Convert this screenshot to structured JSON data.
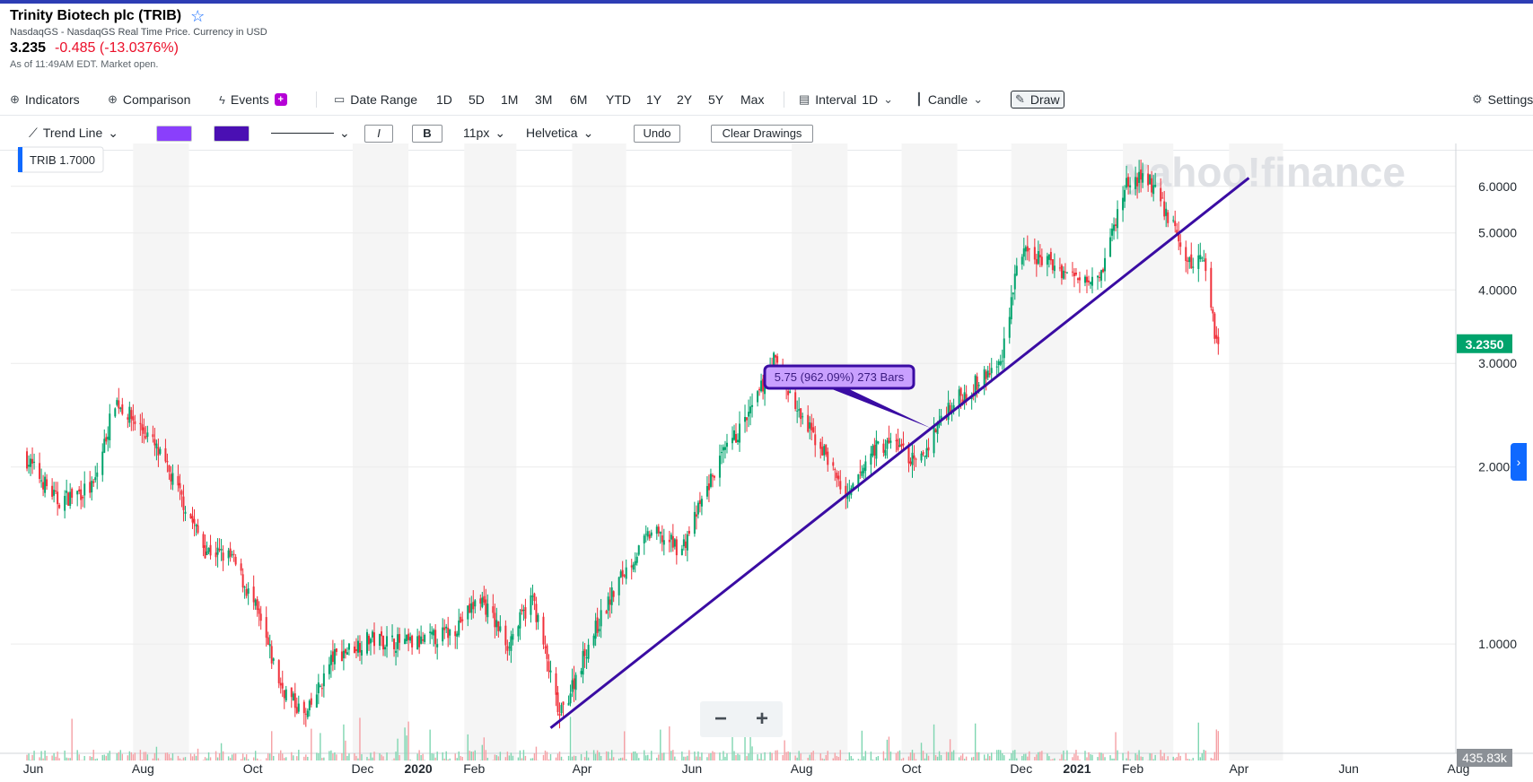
{
  "header": {
    "title": "Trinity Biotech plc (TRIB)",
    "subtitle": "NasdaqGS - NasdaqGS Real Time Price. Currency in USD",
    "price": "3.235",
    "change": "-0.485 (-13.0376%)",
    "as_of": "As of 11:49AM EDT. Market open."
  },
  "toolbar": {
    "indicators": "Indicators",
    "comparison": "Comparison",
    "events": "Events",
    "date_range": "Date Range",
    "ranges": [
      "1D",
      "5D",
      "1M",
      "3M",
      "6M",
      "YTD",
      "1Y",
      "2Y",
      "5Y",
      "Max"
    ],
    "interval_label": "Interval",
    "interval_value": "1D",
    "chart_type": "Candle",
    "draw": "Draw",
    "settings": "Settings"
  },
  "drawbar": {
    "tool": "Trend Line",
    "color1": "#8a3ffc",
    "color2": "#4a0fb3",
    "italic": "I",
    "bold": "B",
    "font_size": "11px",
    "font": "Helvetica",
    "undo": "Undo",
    "clear": "Clear Drawings"
  },
  "chart_data": {
    "type": "candlestick",
    "symbol_label": "TRIB",
    "symbol_value": "1.7000",
    "watermark": "yahoo!finance",
    "x_tick_labels": [
      "Jun",
      "Aug",
      "Oct",
      "Dec",
      "2020",
      "Feb",
      "Apr",
      "Jun",
      "Aug",
      "Oct",
      "Dec",
      "2021",
      "Feb",
      "Apr",
      "Jun",
      "Aug"
    ],
    "y_scale": "log",
    "y_tick_labels": [
      "6.0000",
      "5.0000",
      "4.0000",
      "3.0000",
      "2.0000",
      "1.0000"
    ],
    "y_ticks": [
      6.0,
      5.0,
      4.0,
      3.0,
      2.0,
      1.0
    ],
    "ylim": [
      0.68,
      6.9
    ],
    "current_price_label": "3.2350",
    "current_price": 3.235,
    "volume_label": "435.83k",
    "price_path": [
      [
        "2019-06-01",
        2.1
      ],
      [
        "2019-06-20",
        1.75
      ],
      [
        "2019-07-10",
        1.85
      ],
      [
        "2019-07-22",
        2.6
      ],
      [
        "2019-08-10",
        2.25
      ],
      [
        "2019-08-25",
        1.85
      ],
      [
        "2019-09-10",
        1.45
      ],
      [
        "2019-09-25",
        1.4
      ],
      [
        "2019-10-08",
        1.15
      ],
      [
        "2019-10-22",
        0.85
      ],
      [
        "2019-11-05",
        0.75
      ],
      [
        "2019-11-20",
        0.95
      ],
      [
        "2019-12-10",
        1.02
      ],
      [
        "2020-01-05",
        1.0
      ],
      [
        "2020-01-25",
        1.05
      ],
      [
        "2020-02-10",
        1.2
      ],
      [
        "2020-02-25",
        1.0
      ],
      [
        "2020-03-10",
        1.2
      ],
      [
        "2020-03-25",
        0.75
      ],
      [
        "2020-04-10",
        1.0
      ],
      [
        "2020-04-28",
        1.3
      ],
      [
        "2020-05-15",
        1.55
      ],
      [
        "2020-06-01",
        1.45
      ],
      [
        "2020-06-20",
        2.0
      ],
      [
        "2020-07-10",
        2.5
      ],
      [
        "2020-07-22",
        3.05
      ],
      [
        "2020-08-05",
        2.45
      ],
      [
        "2020-08-20",
        2.1
      ],
      [
        "2020-09-01",
        1.75
      ],
      [
        "2020-09-15",
        2.15
      ],
      [
        "2020-09-28",
        2.2
      ],
      [
        "2020-10-10",
        2.0
      ],
      [
        "2020-10-25",
        2.5
      ],
      [
        "2020-11-10",
        2.75
      ],
      [
        "2020-11-25",
        3.0
      ],
      [
        "2020-12-05",
        4.6
      ],
      [
        "2020-12-20",
        4.5
      ],
      [
        "2021-01-05",
        4.2
      ],
      [
        "2021-01-20",
        4.3
      ],
      [
        "2021-02-03",
        6.1
      ],
      [
        "2021-02-15",
        6.2
      ],
      [
        "2021-02-28",
        5.2
      ],
      [
        "2021-03-10",
        4.4
      ],
      [
        "2021-03-18",
        4.6
      ],
      [
        "2021-03-24",
        3.4
      ],
      [
        "2021-03-26",
        3.235
      ]
    ],
    "trend_line": {
      "start": [
        "2020-03-20",
        0.72
      ],
      "end": [
        "2021-04-12",
        6.2
      ],
      "label": "5.75 (962.09%) 273 Bars"
    }
  },
  "colors": {
    "up": "#00a36c",
    "down": "#f0303a",
    "trend": "#3a0ca3",
    "label_fill": "#c9a0ff",
    "price_badge": "#00a36c"
  }
}
